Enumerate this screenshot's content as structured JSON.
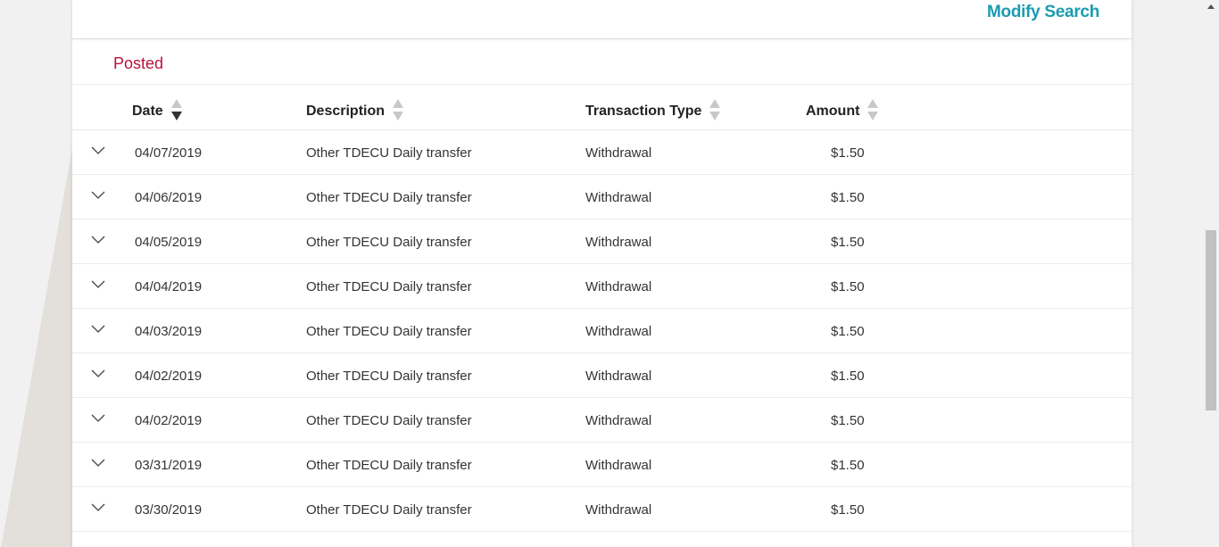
{
  "toolbar": {
    "modify_search_label": "Modify Search"
  },
  "section": {
    "title": "Posted"
  },
  "table": {
    "columns": [
      {
        "label": "Date",
        "sort": "descending"
      },
      {
        "label": "Description",
        "sort": "none"
      },
      {
        "label": "Transaction Type",
        "sort": "none"
      },
      {
        "label": "Amount",
        "sort": "none"
      }
    ],
    "rows": [
      {
        "date": "04/07/2019",
        "description": "Other TDECU Daily transfer",
        "type": "Withdrawal",
        "amount": "$1.50"
      },
      {
        "date": "04/06/2019",
        "description": "Other TDECU Daily transfer",
        "type": "Withdrawal",
        "amount": "$1.50"
      },
      {
        "date": "04/05/2019",
        "description": "Other TDECU Daily transfer",
        "type": "Withdrawal",
        "amount": "$1.50"
      },
      {
        "date": "04/04/2019",
        "description": "Other TDECU Daily transfer",
        "type": "Withdrawal",
        "amount": "$1.50"
      },
      {
        "date": "04/03/2019",
        "description": "Other TDECU Daily transfer",
        "type": "Withdrawal",
        "amount": "$1.50"
      },
      {
        "date": "04/02/2019",
        "description": "Other TDECU Daily transfer",
        "type": "Withdrawal",
        "amount": "$1.50"
      },
      {
        "date": "04/02/2019",
        "description": "Other TDECU Daily transfer",
        "type": "Withdrawal",
        "amount": "$1.50"
      },
      {
        "date": "03/31/2019",
        "description": "Other TDECU Daily transfer",
        "type": "Withdrawal",
        "amount": "$1.50"
      },
      {
        "date": "03/30/2019",
        "description": "Other TDECU Daily transfer",
        "type": "Withdrawal",
        "amount": "$1.50"
      }
    ]
  },
  "colors": {
    "accent_link": "#1b9bb0",
    "section_title": "#b8123e"
  },
  "icons": {
    "row_expand": "chevron-down-icon",
    "sort": "sort-arrows-icon"
  }
}
